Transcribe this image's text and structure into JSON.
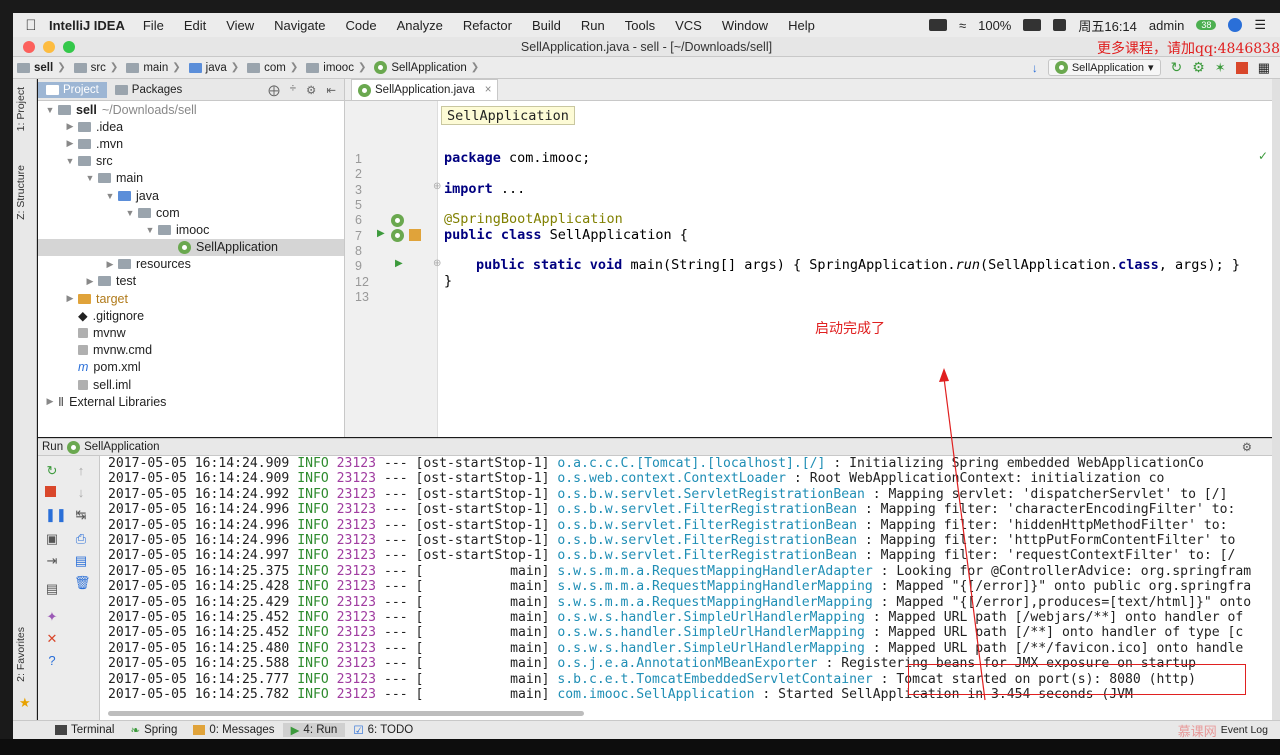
{
  "menubar": {
    "app": "IntelliJ IDEA",
    "items": [
      "File",
      "Edit",
      "View",
      "Navigate",
      "Code",
      "Analyze",
      "Refactor",
      "Build",
      "Run",
      "Tools",
      "VCS",
      "Window",
      "Help"
    ],
    "battery": "100%",
    "clock": "周五16:14",
    "user": "admin",
    "badge": "38"
  },
  "window": {
    "title": "SellApplication.java - sell - [~/Downloads/sell]",
    "watermark": "更多课程，请加qq:4846838"
  },
  "breadcrumb": [
    "sell",
    "src",
    "main",
    "java",
    "com",
    "imooc",
    "SellApplication"
  ],
  "toolbar": {
    "run_config": "SellApplication"
  },
  "sidebar_tabs": {
    "project": "1: Project",
    "structure": "Z: Structure",
    "favorites": "2: Favorites"
  },
  "project_panel": {
    "tabs": [
      "Project",
      "Packages"
    ],
    "tree": [
      {
        "label": "sell",
        "suffix": "~/Downloads/sell",
        "depth": 0,
        "arrow": "▼",
        "icon": "folder",
        "bold": true
      },
      {
        "label": ".idea",
        "depth": 1,
        "arrow": "▶",
        "icon": "folder"
      },
      {
        "label": ".mvn",
        "depth": 1,
        "arrow": "▶",
        "icon": "folder"
      },
      {
        "label": "src",
        "depth": 1,
        "arrow": "▼",
        "icon": "folder"
      },
      {
        "label": "main",
        "depth": 2,
        "arrow": "▼",
        "icon": "folder"
      },
      {
        "label": "java",
        "depth": 3,
        "arrow": "▼",
        "icon": "folder-blue"
      },
      {
        "label": "com",
        "depth": 4,
        "arrow": "▼",
        "icon": "folder"
      },
      {
        "label": "imooc",
        "depth": 5,
        "arrow": "▼",
        "icon": "folder"
      },
      {
        "label": "SellApplication",
        "depth": 6,
        "arrow": "",
        "icon": "spring",
        "selected": true
      },
      {
        "label": "resources",
        "depth": 3,
        "arrow": "▶",
        "icon": "folder"
      },
      {
        "label": "test",
        "depth": 2,
        "arrow": "▶",
        "icon": "folder"
      },
      {
        "label": "target",
        "depth": 1,
        "arrow": "▶",
        "icon": "folder-orange"
      },
      {
        "label": ".gitignore",
        "depth": 1,
        "arrow": "",
        "icon": "git"
      },
      {
        "label": "mvnw",
        "depth": 1,
        "arrow": "",
        "icon": "file"
      },
      {
        "label": "mvnw.cmd",
        "depth": 1,
        "arrow": "",
        "icon": "file"
      },
      {
        "label": "pom.xml",
        "depth": 1,
        "arrow": "",
        "icon": "maven"
      },
      {
        "label": "sell.iml",
        "depth": 1,
        "arrow": "",
        "icon": "file"
      },
      {
        "label": "External Libraries",
        "depth": 0,
        "arrow": "▶",
        "icon": "lib"
      }
    ]
  },
  "editor": {
    "tab": "SellApplication.java",
    "hint": "SellApplication",
    "line_numbers": [
      "1",
      "2",
      "3",
      "5",
      "6",
      "7",
      "8",
      "9",
      "12",
      "13"
    ],
    "code": {
      "l1_kw": "package",
      "l1_rest": " com.imooc;",
      "l3_kw": "import",
      "l3_rest": " ...",
      "l6": "@SpringBootApplication",
      "l7_kw": "public class",
      "l7_rest": " SellApplication {",
      "l9_kw": "public static void",
      "l9_a": " main(String[] args) { SpringApplication.",
      "l9_run": "run",
      "l9_b": "(SellApplication.",
      "l9_cls": "class",
      "l9_c": ", args); }",
      "l12": "}"
    }
  },
  "annotation_note": "启动完成了",
  "run_panel": {
    "label": "Run",
    "config": "SellApplication",
    "logs": [
      {
        "ts": "2017-05-05 16:14:24.909",
        "level": "INFO",
        "pid": "23123",
        "sep": "---",
        "thread": "[ost-startStop-1]",
        "logger": "o.a.c.c.C.[Tomcat].[localhost].[/]",
        "msg": ": Initializing Spring embedded WebApplicationCo"
      },
      {
        "ts": "2017-05-05 16:14:24.909",
        "level": "INFO",
        "pid": "23123",
        "sep": "---",
        "thread": "[ost-startStop-1]",
        "logger": "o.s.web.context.ContextLoader",
        "msg": ": Root WebApplicationContext: initialization co"
      },
      {
        "ts": "2017-05-05 16:14:24.992",
        "level": "INFO",
        "pid": "23123",
        "sep": "---",
        "thread": "[ost-startStop-1]",
        "logger": "o.s.b.w.servlet.ServletRegistrationBean",
        "msg": ": Mapping servlet: 'dispatcherServlet' to [/]"
      },
      {
        "ts": "2017-05-05 16:14:24.996",
        "level": "INFO",
        "pid": "23123",
        "sep": "---",
        "thread": "[ost-startStop-1]",
        "logger": "o.s.b.w.servlet.FilterRegistrationBean",
        "msg": ": Mapping filter: 'characterEncodingFilter' to:"
      },
      {
        "ts": "2017-05-05 16:14:24.996",
        "level": "INFO",
        "pid": "23123",
        "sep": "---",
        "thread": "[ost-startStop-1]",
        "logger": "o.s.b.w.servlet.FilterRegistrationBean",
        "msg": ": Mapping filter: 'hiddenHttpMethodFilter' to:"
      },
      {
        "ts": "2017-05-05 16:14:24.996",
        "level": "INFO",
        "pid": "23123",
        "sep": "---",
        "thread": "[ost-startStop-1]",
        "logger": "o.s.b.w.servlet.FilterRegistrationBean",
        "msg": ": Mapping filter: 'httpPutFormContentFilter' to"
      },
      {
        "ts": "2017-05-05 16:14:24.997",
        "level": "INFO",
        "pid": "23123",
        "sep": "---",
        "thread": "[ost-startStop-1]",
        "logger": "o.s.b.w.servlet.FilterRegistrationBean",
        "msg": ": Mapping filter: 'requestContextFilter' to: [/"
      },
      {
        "ts": "2017-05-05 16:14:25.375",
        "level": "INFO",
        "pid": "23123",
        "sep": "---",
        "thread": "[           main]",
        "logger": "s.w.s.m.m.a.RequestMappingHandlerAdapter",
        "msg": ": Looking for @ControllerAdvice: org.springfram"
      },
      {
        "ts": "2017-05-05 16:14:25.428",
        "level": "INFO",
        "pid": "23123",
        "sep": "---",
        "thread": "[           main]",
        "logger": "s.w.s.m.m.a.RequestMappingHandlerMapping",
        "msg": ": Mapped \"{[/error]}\" onto public org.springfra"
      },
      {
        "ts": "2017-05-05 16:14:25.429",
        "level": "INFO",
        "pid": "23123",
        "sep": "---",
        "thread": "[           main]",
        "logger": "s.w.s.m.m.a.RequestMappingHandlerMapping",
        "msg": ": Mapped \"{[/error],produces=[text/html]}\" onto"
      },
      {
        "ts": "2017-05-05 16:14:25.452",
        "level": "INFO",
        "pid": "23123",
        "sep": "---",
        "thread": "[           main]",
        "logger": "o.s.w.s.handler.SimpleUrlHandlerMapping",
        "msg": ": Mapped URL path [/webjars/**] onto handler of"
      },
      {
        "ts": "2017-05-05 16:14:25.452",
        "level": "INFO",
        "pid": "23123",
        "sep": "---",
        "thread": "[           main]",
        "logger": "o.s.w.s.handler.SimpleUrlHandlerMapping",
        "msg": ": Mapped URL path [/**] onto handler of type [c"
      },
      {
        "ts": "2017-05-05 16:14:25.480",
        "level": "INFO",
        "pid": "23123",
        "sep": "---",
        "thread": "[           main]",
        "logger": "o.s.w.s.handler.SimpleUrlHandlerMapping",
        "msg": ": Mapped URL path [/**/favicon.ico] onto handle"
      },
      {
        "ts": "2017-05-05 16:14:25.588",
        "level": "INFO",
        "pid": "23123",
        "sep": "---",
        "thread": "[           main]",
        "logger": "o.s.j.e.a.AnnotationMBeanExporter",
        "msg": ": Registering beans for JMX exposure on startup"
      },
      {
        "ts": "2017-05-05 16:14:25.777",
        "level": "INFO",
        "pid": "23123",
        "sep": "---",
        "thread": "[           main]",
        "logger": "s.b.c.e.t.TomcatEmbeddedServletContainer",
        "msg": ": Tomcat started on port(s): 8080 (http)"
      },
      {
        "ts": "2017-05-05 16:14:25.782",
        "level": "INFO",
        "pid": "23123",
        "sep": "---",
        "thread": "[           main]",
        "logger": "com.imooc.SellApplication",
        "msg": ": Started SellApplication in 3.454 seconds (JVM"
      }
    ]
  },
  "statusbar": {
    "tabs": [
      "Terminal",
      "Spring",
      "0: Messages",
      "4: Run",
      "6: TODO"
    ],
    "event_log": "Event Log",
    "brand": "慕课网"
  },
  "colors": {
    "accent_red": "#e02020",
    "info_green": "#2e8b2e",
    "pid_purple": "#a03ca0",
    "logger_blue": "#1f8eb5",
    "keyword": "#000080",
    "annotation": "#808000"
  }
}
